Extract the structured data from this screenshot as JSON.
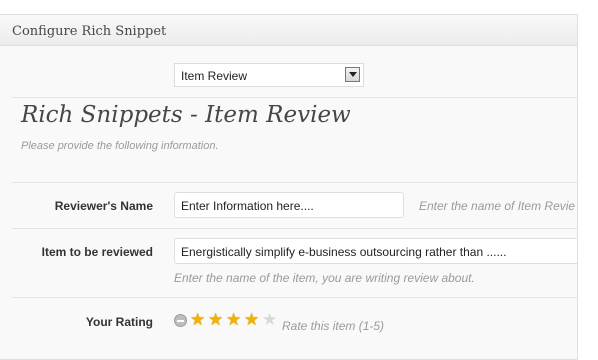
{
  "panel": {
    "title": "Configure Rich Snippet"
  },
  "type_select": {
    "selected": "Item Review"
  },
  "section": {
    "heading": "Rich Snippets - Item Review",
    "subtext": "Please provide the following information."
  },
  "fields": {
    "reviewer": {
      "label": "Reviewer's Name",
      "value": "Enter Information here....",
      "hint": "Enter the name of Item Revie"
    },
    "item": {
      "label": "Item to be reviewed",
      "value": "Energistically simplify e-business outsourcing rather than ......",
      "hint": "Enter the name of the item, you are writing review about."
    },
    "rating": {
      "label": "Your Rating",
      "value": 4,
      "max": 5,
      "hint": "Rate this item (1-5)"
    }
  },
  "colors": {
    "star_on": "#f0b400",
    "star_off": "#d8d8d8"
  }
}
